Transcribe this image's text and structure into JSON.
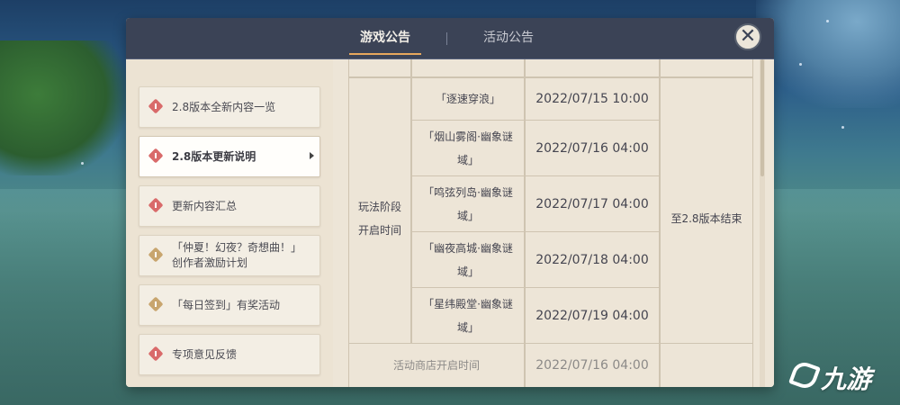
{
  "tabs": [
    {
      "label": "游戏公告",
      "active": true
    },
    {
      "label": "活动公告",
      "active": false
    }
  ],
  "close_icon": "close-icon",
  "sidebar": {
    "items": [
      {
        "label": "2.8版本全新内容一览",
        "icon": "alert-icon",
        "icon_color": "#d96a6a",
        "active": false
      },
      {
        "label": "2.8版本更新说明",
        "icon": "alert-icon",
        "icon_color": "#d96a6a",
        "active": true
      },
      {
        "label": "更新内容汇总",
        "icon": "alert-icon",
        "icon_color": "#d96a6a",
        "active": false
      },
      {
        "label": "「仲夏！幻夜？奇想曲！」创作者激励计划",
        "line1": "「仲夏！幻夜？奇想曲！」",
        "line2": "创作者激励计划",
        "icon": "event-icon",
        "icon_color": "#c8a56e",
        "active": false
      },
      {
        "label": "「每日签到」有奖活动",
        "icon": "event-icon",
        "icon_color": "#c8a56e",
        "active": false
      },
      {
        "label": "专项意见反馈",
        "icon": "alert-icon",
        "icon_color": "#d96a6a",
        "active": false
      }
    ]
  },
  "table": {
    "group_label_line1": "玩法阶段",
    "group_label_line2": "开启时间",
    "end_label": "至2.8版本结束",
    "rows": [
      {
        "name": "「逐速穿浪」",
        "time": "2022/07/15 10:00"
      },
      {
        "name_line1": "「烟山雾阁·幽象谜",
        "name_line2": "域」",
        "time": "2022/07/16 04:00"
      },
      {
        "name_line1": "「鸣弦列岛·幽象谜",
        "name_line2": "域」",
        "time": "2022/07/17 04:00"
      },
      {
        "name_line1": "「幽夜高城·幽象谜",
        "name_line2": "域」",
        "time": "2022/07/18 04:00"
      },
      {
        "name_line1": "「星纬殿堂·幽象谜",
        "name_line2": "域」",
        "time": "2022/07/19 04:00"
      }
    ],
    "shop_row": {
      "label": "活动商店开启时间",
      "time": "2022/07/16 04:00"
    }
  },
  "watermark": {
    "text": "九游"
  },
  "colors": {
    "accent": "#e7a75d",
    "header_bg": "#3b4356",
    "panel_bg": "#ede5d7",
    "alert_red": "#d96a6a",
    "event_gold": "#c8a56e"
  }
}
